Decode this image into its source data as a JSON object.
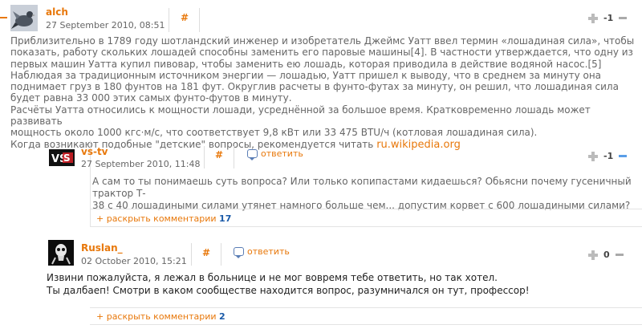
{
  "comments": [
    {
      "author": "alch",
      "date": "27 September 2010, 08:51",
      "hash": "#",
      "score": "-1",
      "avatar_icon": "pigeon-avatar",
      "body": [
        "Приблизительно в 1789 году шотландский инженер и изобретатель Джеймс Уатт ввел термин «лошадиная сила», чтобы",
        "показать, работу скольких лошадей способны заменить его паровые машины[4]. В частности утверждается, что одну из",
        "первых машин Уатта купил пивовар, чтобы заменить ею лошадь, которая приводила в действие водяной насос.[5]",
        "Наблюдая за традиционным источником энергии — лошадью, Уатт пришел к выводу, что в среднем за минуту она",
        "поднимает груз в 180 фунтов на 181 фут. Округлив расчеты в фунто-футах за минуту, он решил, что лошадиная сила",
        "будет равна 33 000 этих самых фунто-футов в минуту.",
        "Расчёты Уатта относились к мощности лошади, усреднённой за большое время. Кратковременно лошадь может развивать",
        "мощность около 1000 кгс·м/с, что соответствует 9,8 кВт или 33 475 BTU/ч (котловая лошадиная сила).",
        "Когда возникают подобные \"детские\" вопросы, рекомендуется читать "
      ],
      "link": "ru.wikipedia.org"
    },
    {
      "author": "vs-tv",
      "date": "27 September 2010, 11:48",
      "hash": "#",
      "reply": "ответить",
      "score": "-1",
      "avatar_text": "VS",
      "body": [
        "А сам то ты понимаешь суть вопроса? Или только копипастами кидаешься? Обьясни почему гусеничный трактор Т-",
        "38 с 40 лошадиными силами утянет намного больше чем... допустим корвет с 600 лошадиными силами?"
      ],
      "expand_label": "+ раскрыть комментарии",
      "expand_count": "17"
    },
    {
      "author": "Ruslan_",
      "date": "02 October 2010, 15:21",
      "hash": "#",
      "reply": "ответить",
      "score": "0",
      "avatar_icon": "skull-avatar",
      "body": [
        "Извини пожалуйста, я лежал в больнице и не мог вовремя тебе ответить, но так хотел.",
        "Ты далбаеп! Смотри в каком сообществе находится вопрос, разумничался он тут, профессор!"
      ],
      "expand_label": "+ раскрыть комментарии",
      "expand_count": "2"
    }
  ],
  "colors": {
    "accent": "#e8780b",
    "link_blue": "#1a5aa8",
    "reply_icon": "#5a7db5"
  }
}
